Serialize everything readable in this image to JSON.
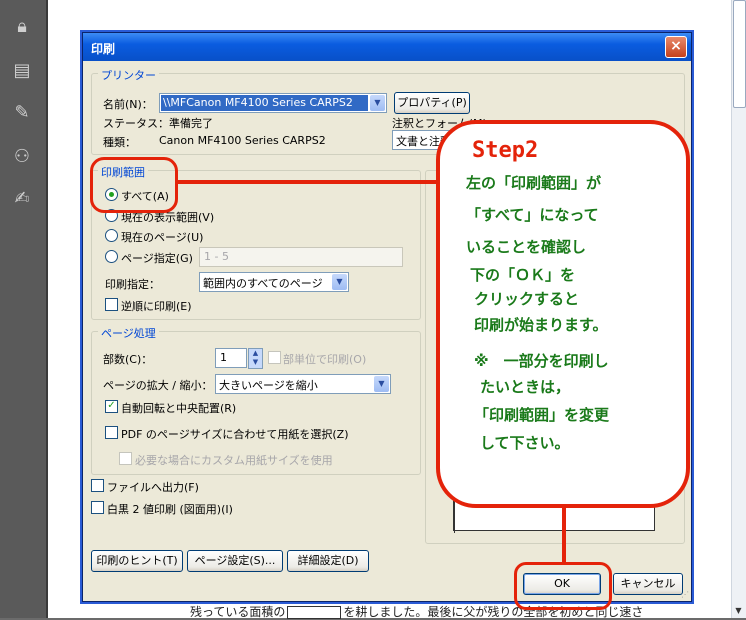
{
  "dialog": {
    "title": "印刷",
    "close_glyph": "×"
  },
  "printer": {
    "group_title": "プリンター",
    "name_label": "名前(N)：",
    "name_value": "\\\\MFCanon MF4100 Series CARPS2",
    "properties_button": "プロパティ(P)",
    "status_label": "ステータス：準備完了",
    "type_label": "種類：",
    "type_value": "Canon MF4100 Series CARPS2",
    "comments_label": "注釈とフォーム(M)：",
    "comments_value": "文書と注釈"
  },
  "range": {
    "group_title": "印刷範囲",
    "all": "すべて(A)",
    "current_view": "現在の表示範囲(V)",
    "current_page": "現在のページ(U)",
    "pages": "ページ指定(G)",
    "pages_value": "1 - 5",
    "subset_label": "印刷指定：",
    "subset_value": "範囲内のすべてのページ",
    "reverse": "逆順に印刷(E)"
  },
  "handling": {
    "group_title": "ページ処理",
    "copies_label": "部数(C)：",
    "copies_value": "1",
    "collate": "部単位で印刷(O)",
    "scaling_label": "ページの拡大 / 縮小：",
    "scaling_value": "大きいページを縮小",
    "autorotate": "自動回転と中央配置(R)",
    "choose_paper": "PDF のページサイズに合わせて用紙を選択(Z)",
    "custom_paper": "必要な場合にカスタム用紙サイズを使用"
  },
  "options": {
    "print_to_file": "ファイルへ出力(F)",
    "bw": "白黒 2 値印刷 (図面用)(I)"
  },
  "footer": {
    "tips": "印刷のヒント(T)",
    "page_setup": "ページ設定(S)...",
    "advanced": "詳細設定(D)",
    "ok": "OK",
    "cancel": "キャンセル"
  },
  "callout": {
    "title": "Step2",
    "lines": [
      "左の「印刷範囲」が",
      "「すべて」になって",
      "いることを確認し",
      "下の「ＯＫ」を",
      "クリックすると",
      "印刷が始まります。",
      "※　一部分を印刷し",
      "たいときは，",
      "「印刷範囲」を変更",
      "して下さい。"
    ]
  },
  "document": {
    "text_before": "残っている面積の",
    "text_after": "を耕しました。最後に父が残りの全部を初めと同じ速さ"
  },
  "colors": {
    "accent_red": "#e4230a",
    "callout_text": "#1a7a1a",
    "title_blue": "#0a5ce0"
  }
}
